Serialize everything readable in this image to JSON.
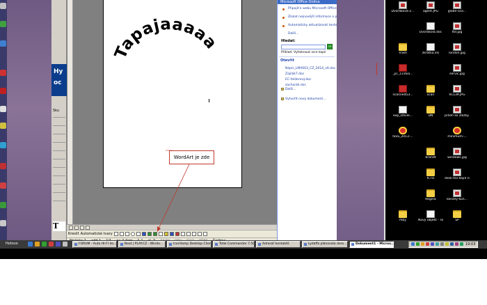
{
  "word": {
    "wordart_text": "Tapajaaaaa",
    "callout_text": "WordArt je zde",
    "draw_label": "Kreslit",
    "autoshapes_label": "Automatické tvary",
    "status": {
      "page": "Stránka 1",
      "section": "odd 1",
      "pages": "1/1",
      "position": "na 2,4cm",
      "line": "ř. 1",
      "col": "sl. 2",
      "rec": "ZÁZN",
      "trk": "REV",
      "ext": "ROZ",
      "ovr": "PŘES",
      "language": "Čeština"
    }
  },
  "task_pane": {
    "title": "Microsoft Office Online",
    "links": [
      "Připojit k webu Microsoft Office Online",
      "Získat nejnovější informace o použití aplikace Word",
      "Automaticky aktualizovat tento seznam z webu",
      "Další..."
    ],
    "search_label": "Hledat:",
    "search_go": "→",
    "search_example": "Příklad: Vytisknout více kopií",
    "open_title": "Otevřít",
    "files": [
      "Nápis_LMA003_CZ_2014_v6.doc",
      "Zajilák7.doc",
      "EC-folderový.doc",
      "zacharák.doc",
      "Další..."
    ],
    "new_doc": "Vytvořit nový dokument..."
  },
  "left_panel": {
    "banner_chars": [
      "Hy",
      "oc"
    ],
    "section_label": "Sku",
    "logo_char": "T"
  },
  "desktop_icons": [
    {
      "label": "Dvořáková-2...",
      "kind": "img"
    },
    {
      "label": "agent.JPG",
      "kind": "img"
    },
    {
      "label": "globe-oca...",
      "kind": "img"
    },
    {
      "label": "Dvořákola.doc",
      "kind": "doc"
    },
    {
      "label": "ttd.jpg",
      "kind": "img"
    },
    {
      "label": "Trash",
      "kind": "folder"
    },
    {
      "label": "zkrátka.xls",
      "kind": "doc"
    },
    {
      "label": "london.jpg",
      "kind": "img"
    },
    {
      "label": "_pr_1116ia...",
      "kind": "pdf"
    },
    {
      "label": "servic.jpg",
      "kind": "img"
    },
    {
      "label": "scanned53...",
      "kind": "pdf"
    },
    {
      "label": "scan",
      "kind": "folder"
    },
    {
      "label": "91139.JPG",
      "kind": "img"
    },
    {
      "label": "exp_smiile...",
      "kind": "doc"
    },
    {
      "label": "DN",
      "kind": "folder"
    },
    {
      "label": "príloh ex zložky...",
      "kind": "img"
    },
    {
      "label": "ISSS_2013-...",
      "kind": "app"
    },
    {
      "label": "minimum-...",
      "kind": "app"
    },
    {
      "label": "brandt",
      "kind": "folder"
    },
    {
      "label": "windows.jpg",
      "kind": "img"
    },
    {
      "label": "ICTU",
      "kind": "folder"
    },
    {
      "label": "desk-fov-kejid nezájem.jpg",
      "kind": "img"
    },
    {
      "label": "Regina",
      "kind": "folder"
    },
    {
      "label": "konzey-kun...",
      "kind": "img"
    },
    {
      "label": "mby",
      "kind": "folder"
    },
    {
      "label": "Nový objekt - Textový d...",
      "kind": "doc"
    },
    {
      "label": "SP",
      "kind": "folder"
    }
  ],
  "taskbar": {
    "start_status": "Hotovo",
    "buttons": [
      "FORUM - Auto HI-FI do...",
      "Beat | PLAY.CZ - Windo...",
      "IconVamp Desktop Client",
      "Total Commander 7.50...",
      "Adresář kontaktů",
      "Lydaffa plánovala doro...",
      "Dokument1 - Micros..."
    ],
    "clock": "19:03"
  },
  "colors": {
    "callout_border": "#c0392b",
    "arrow": "#c0392b",
    "task_pane_header": "#3d6cc8",
    "link": "#1a3fa8"
  }
}
